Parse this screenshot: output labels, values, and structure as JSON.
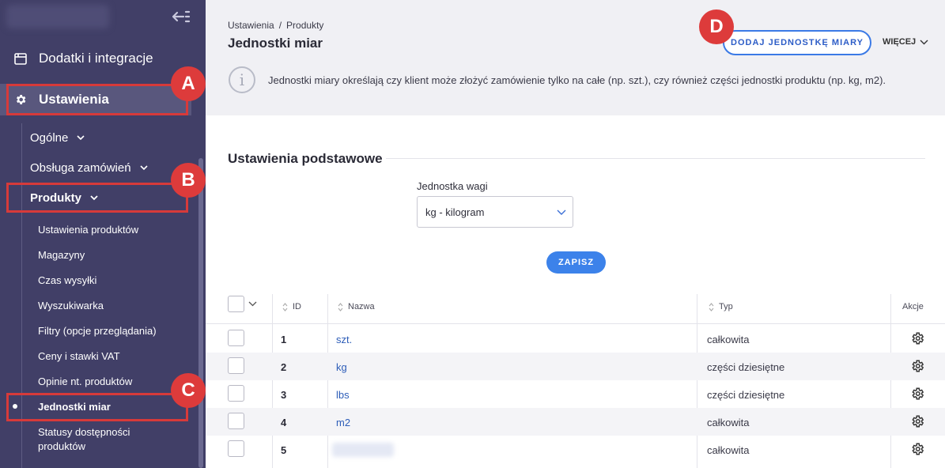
{
  "sidebar": {
    "addons": "Dodatki i integracje",
    "settings": "Ustawienia",
    "sub": {
      "general": "Ogólne",
      "orders": "Obsługa zamówień",
      "products": "Produkty"
    },
    "leaves": [
      "Ustawienia produktów",
      "Magazyny",
      "Czas wysyłki",
      "Wyszukiwarka",
      "Filtry (opcje przeglądania)",
      "Ceny i stawki VAT",
      "Opinie nt. produktów",
      "Jednostki miar",
      "Statusy dostępności produktów"
    ]
  },
  "badges": [
    "A",
    "B",
    "C",
    "D"
  ],
  "header": {
    "crumb_root": "Ustawienia",
    "crumb_sep": "/",
    "crumb_current": "Produkty",
    "title": "Jednostki miar",
    "add_button": "DODAJ JEDNOSTKĘ MIARY",
    "more": "WIĘCEJ",
    "info_icon": "i",
    "info": "Jednostki miary określają czy klient może złożyć zamówienie tylko na całe (np. szt.), czy również części jednostki produktu (np. kg, m2)."
  },
  "basic": {
    "title": "Ustawienia podstawowe",
    "weight_label": "Jednostka wagi",
    "weight_value": "kg - kilogram",
    "save": "ZAPISZ"
  },
  "table": {
    "columns": {
      "id": "ID",
      "name": "Nazwa",
      "type": "Typ",
      "actions": "Akcje"
    },
    "rows": [
      {
        "id": "1",
        "name": "szt.",
        "type": "całkowita"
      },
      {
        "id": "2",
        "name": "kg",
        "type": "części dziesiętne"
      },
      {
        "id": "3",
        "name": "lbs",
        "type": "części dziesiętne"
      },
      {
        "id": "4",
        "name": "m2",
        "type": "całkowita"
      },
      {
        "id": "5",
        "name": "",
        "type": "całkowita"
      }
    ]
  },
  "colors": {
    "sidebar": "#413f67",
    "accent": "#3c82ea",
    "highlight": "#d73a3a",
    "link": "#2d5db8"
  }
}
